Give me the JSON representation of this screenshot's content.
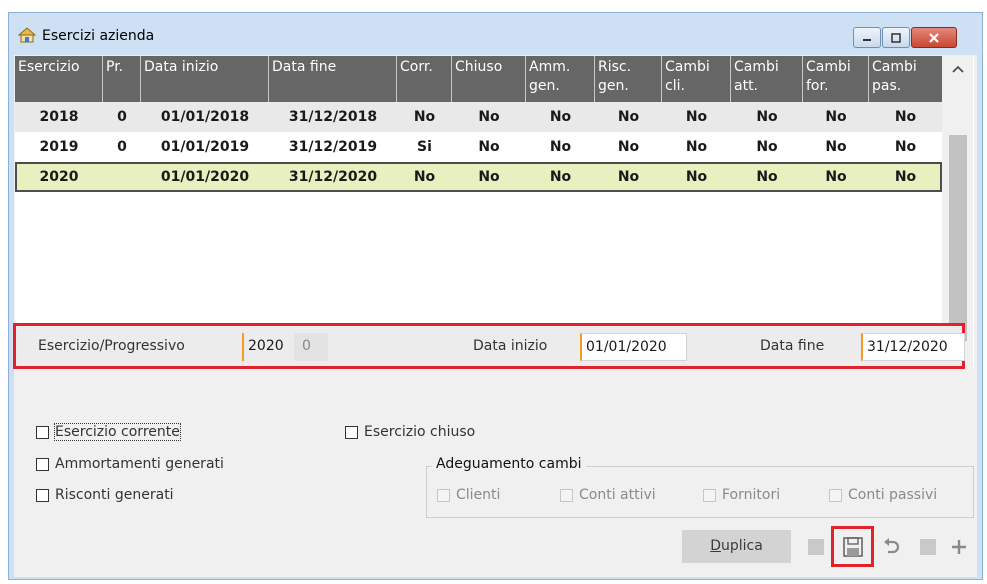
{
  "window": {
    "title": "Esercizi azienda"
  },
  "grid": {
    "columns": [
      "Esercizio",
      "Pr.",
      "Data inizio",
      "Data fine",
      "Corr.",
      "Chiuso",
      "Amm.\ngen.",
      "Risc.\ngen.",
      "Cambi\ncli.",
      "Cambi\natt.",
      "Cambi\nfor.",
      "Cambi\npas."
    ],
    "rows": [
      [
        "2018",
        "0",
        "01/01/2018",
        "31/12/2018",
        "No",
        "No",
        "No",
        "No",
        "No",
        "No",
        "No",
        "No"
      ],
      [
        "2019",
        "0",
        "01/01/2019",
        "31/12/2019",
        "Si",
        "No",
        "No",
        "No",
        "No",
        "No",
        "No",
        "No"
      ],
      [
        "2020",
        "",
        "01/01/2020",
        "31/12/2020",
        "No",
        "No",
        "No",
        "No",
        "No",
        "No",
        "No",
        "No"
      ]
    ],
    "selected_row": 2
  },
  "edit": {
    "esercizio_label": "Esercizio/Progressivo",
    "esercizio_value": "2020",
    "progressivo_value": "0",
    "data_inizio_label": "Data inizio",
    "data_inizio_value": "01/01/2020",
    "data_fine_label": "Data fine",
    "data_fine_value": "31/12/2020"
  },
  "options": {
    "esercizio_corrente": "Esercizio corrente",
    "esercizio_chiuso": "Esercizio chiuso",
    "ammortamenti": "Ammortamenti generati",
    "risconti": "Risconti generati",
    "adeguamento_title": "Adeguamento cambi",
    "clienti": "Clienti",
    "conti_attivi": "Conti attivi",
    "fornitori": "Fornitori",
    "conti_passivi": "Conti passivi"
  },
  "toolbar": {
    "duplica_u": "D",
    "duplica_rest": "uplica"
  },
  "icons": [
    "window-icon",
    "minimize-icon",
    "maximize-icon",
    "close-icon",
    "scroll-up-icon",
    "scroll-down-icon",
    "save-icon",
    "undo-icon",
    "add-icon"
  ],
  "colors": {
    "header_bg": "#666666",
    "selected_row": "#e8f0bf",
    "highlight": "#e4202a",
    "required_marker": "#f39a1f"
  }
}
